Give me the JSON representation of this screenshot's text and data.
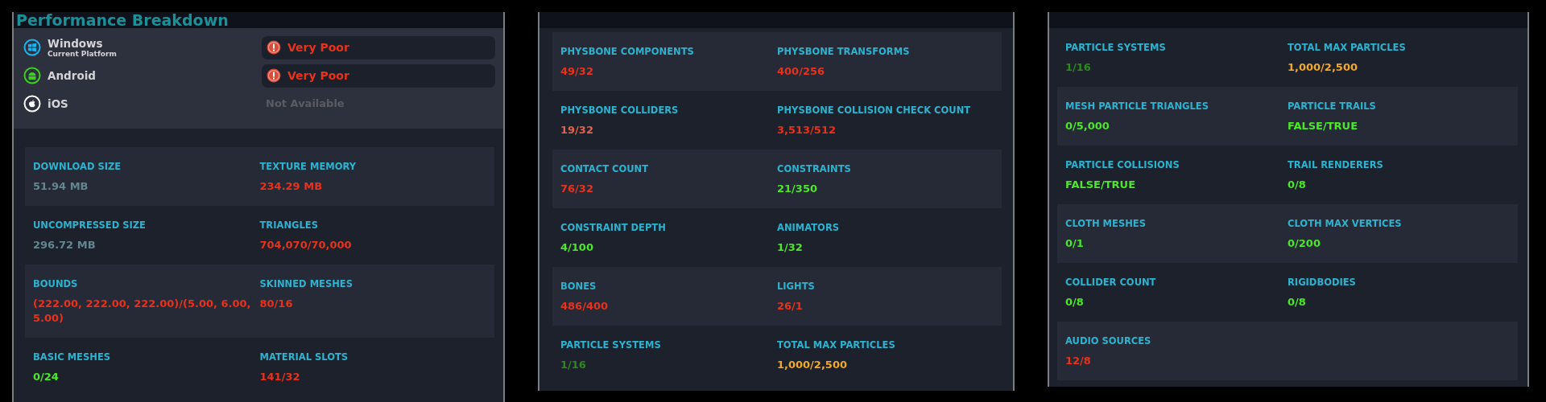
{
  "panels": [
    {
      "title": "Performance Breakdown",
      "platforms": [
        {
          "kind": "windows",
          "name": "Windows",
          "subtitle": "Current Platform",
          "available": true,
          "rating": "Very Poor"
        },
        {
          "kind": "android",
          "name": "Android",
          "available": true,
          "rating": "Very Poor"
        },
        {
          "kind": "apple",
          "name": "iOS",
          "available": false,
          "rating": "Not Available"
        }
      ],
      "rows": [
        {
          "metrics": [
            {
              "label": "DOWNLOAD SIZE",
              "value": "51.94 MB",
              "color": "#63868f"
            },
            {
              "label": "TEXTURE MEMORY",
              "value": "234.29 MB",
              "color": "#e8321c"
            }
          ]
        },
        {
          "metrics": [
            {
              "label": "UNCOMPRESSED SIZE",
              "value": "296.72 MB",
              "color": "#63868f"
            },
            {
              "label": "TRIANGLES",
              "value": "704,070/70,000",
              "color": "#e8321c"
            }
          ]
        },
        {
          "metrics": [
            {
              "label": "BOUNDS",
              "value": "(222.00, 222.00, 222.00)/(5.00, 6.00, 5.00)",
              "color": "#e8321c"
            },
            {
              "label": "SKINNED MESHES",
              "value": "80/16",
              "color": "#e8321c"
            }
          ]
        },
        {
          "metrics": [
            {
              "label": "BASIC MESHES",
              "value": "0/24",
              "color": "#4ce62a"
            },
            {
              "label": "MATERIAL SLOTS",
              "value": "141/32",
              "color": "#e8321c"
            }
          ]
        }
      ]
    },
    {
      "rows": [
        {
          "metrics": [
            {
              "label": "PHYSBONE COMPONENTS",
              "value": "49/32",
              "color": "#e8321c"
            },
            {
              "label": "PHYSBONE TRANSFORMS",
              "value": "400/256",
              "color": "#e8321c"
            }
          ]
        },
        {
          "metrics": [
            {
              "label": "PHYSBONE COLLIDERS",
              "value": "19/32",
              "color": "#e8604a"
            },
            {
              "label": "PHYSBONE COLLISION CHECK COUNT",
              "value": "3,513/512",
              "color": "#e8321c"
            }
          ]
        },
        {
          "metrics": [
            {
              "label": "CONTACT COUNT",
              "value": "76/32",
              "color": "#e8321c"
            },
            {
              "label": "CONSTRAINTS",
              "value": "21/350",
              "color": "#4ce62a"
            }
          ]
        },
        {
          "metrics": [
            {
              "label": "CONSTRAINT DEPTH",
              "value": "4/100",
              "color": "#4ce62a"
            },
            {
              "label": "ANIMATORS",
              "value": "1/32",
              "color": "#4ce62a"
            }
          ]
        },
        {
          "metrics": [
            {
              "label": "BONES",
              "value": "486/400",
              "color": "#e8321c"
            },
            {
              "label": "LIGHTS",
              "value": "26/1",
              "color": "#e8321c"
            }
          ]
        },
        {
          "metrics": [
            {
              "label": "PARTICLE SYSTEMS",
              "value": "1/16",
              "color": "#2e8a1c"
            },
            {
              "label": "TOTAL MAX PARTICLES",
              "value": "1,000/2,500",
              "color": "#f0a830"
            }
          ]
        }
      ]
    },
    {
      "continued": true,
      "rows": [
        {
          "metrics": [
            {
              "label": "PARTICLE SYSTEMS",
              "value": "1/16",
              "color": "#2e8a1c"
            },
            {
              "label": "TOTAL MAX PARTICLES",
              "value": "1,000/2,500",
              "color": "#f0a830"
            }
          ]
        },
        {
          "metrics": [
            {
              "label": "MESH PARTICLE TRIANGLES",
              "value": "0/5,000",
              "color": "#4ce62a"
            },
            {
              "label": "PARTICLE TRAILS",
              "value": "FALSE/TRUE",
              "color": "#4ce62a"
            }
          ]
        },
        {
          "metrics": [
            {
              "label": "PARTICLE COLLISIONS",
              "value": "FALSE/TRUE",
              "color": "#4ce62a"
            },
            {
              "label": "TRAIL RENDERERS",
              "value": "0/8",
              "color": "#4ce62a"
            }
          ]
        },
        {
          "metrics": [
            {
              "label": "CLOTH MESHES",
              "value": "0/1",
              "color": "#4ce62a"
            },
            {
              "label": "CLOTH MAX VERTICES",
              "value": "0/200",
              "color": "#4ce62a"
            }
          ]
        },
        {
          "metrics": [
            {
              "label": "COLLIDER COUNT",
              "value": "0/8",
              "color": "#4ce62a"
            },
            {
              "label": "RIGIDBODIES",
              "value": "0/8",
              "color": "#4ce62a"
            }
          ]
        },
        {
          "metrics": [
            {
              "label": "AUDIO SOURCES",
              "value": "12/8",
              "color": "#e8321c"
            }
          ]
        }
      ]
    }
  ]
}
